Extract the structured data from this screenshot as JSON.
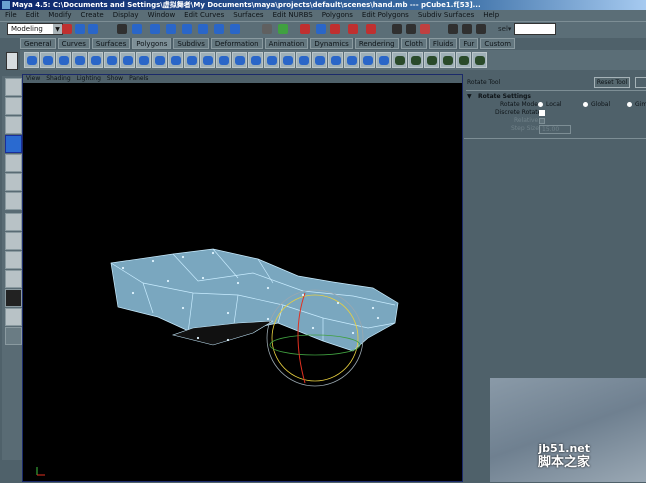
{
  "window": {
    "title": "Maya 4.5: C:\\Documents and Settings\\虚拟舞者\\My Documents\\maya\\projects\\default\\scenes\\hand.mb  ---  pCube1.f[53]..."
  },
  "menubar": [
    "File",
    "Edit",
    "Modify",
    "Create",
    "Display",
    "Window",
    "Edit Curves",
    "Surfaces",
    "Edit NURBS",
    "Polygons",
    "Edit Polygons",
    "Subdiv Surfaces",
    "Help"
  ],
  "toolbar": {
    "mode": "Modeling",
    "sel_label": "sel▾",
    "sel_value": ""
  },
  "shelf_tabs": [
    "General",
    "Curves",
    "Surfaces",
    "Polygons",
    "Subdivs",
    "Deformation",
    "Animation",
    "Dynamics",
    "Rendering",
    "Cloth",
    "Fluids",
    "Fur",
    "Custom"
  ],
  "active_shelf": "Polygons",
  "viewport": {
    "menus": [
      "View",
      "Shading",
      "Lighting",
      "Show",
      "Panels"
    ]
  },
  "tool_settings": {
    "title": "Rotate Tool",
    "reset": "Reset Tool",
    "section": "Rotate Settings",
    "rotate_mode_label": "Rotate Mode",
    "modes": [
      "Local",
      "Global",
      "Gimbal"
    ],
    "selected_mode": "Local",
    "discrete_rotate": "Discrete Rotate",
    "discrete_checked": false,
    "relative": "Relative",
    "step_size": "Step Size",
    "step_value": "15.00"
  },
  "watermark": {
    "site": "jb51.net",
    "name": "脚本之家"
  },
  "colors": {
    "panel": "#4f616a",
    "title": "#0a246a",
    "mesh": "#8fc4e0"
  }
}
